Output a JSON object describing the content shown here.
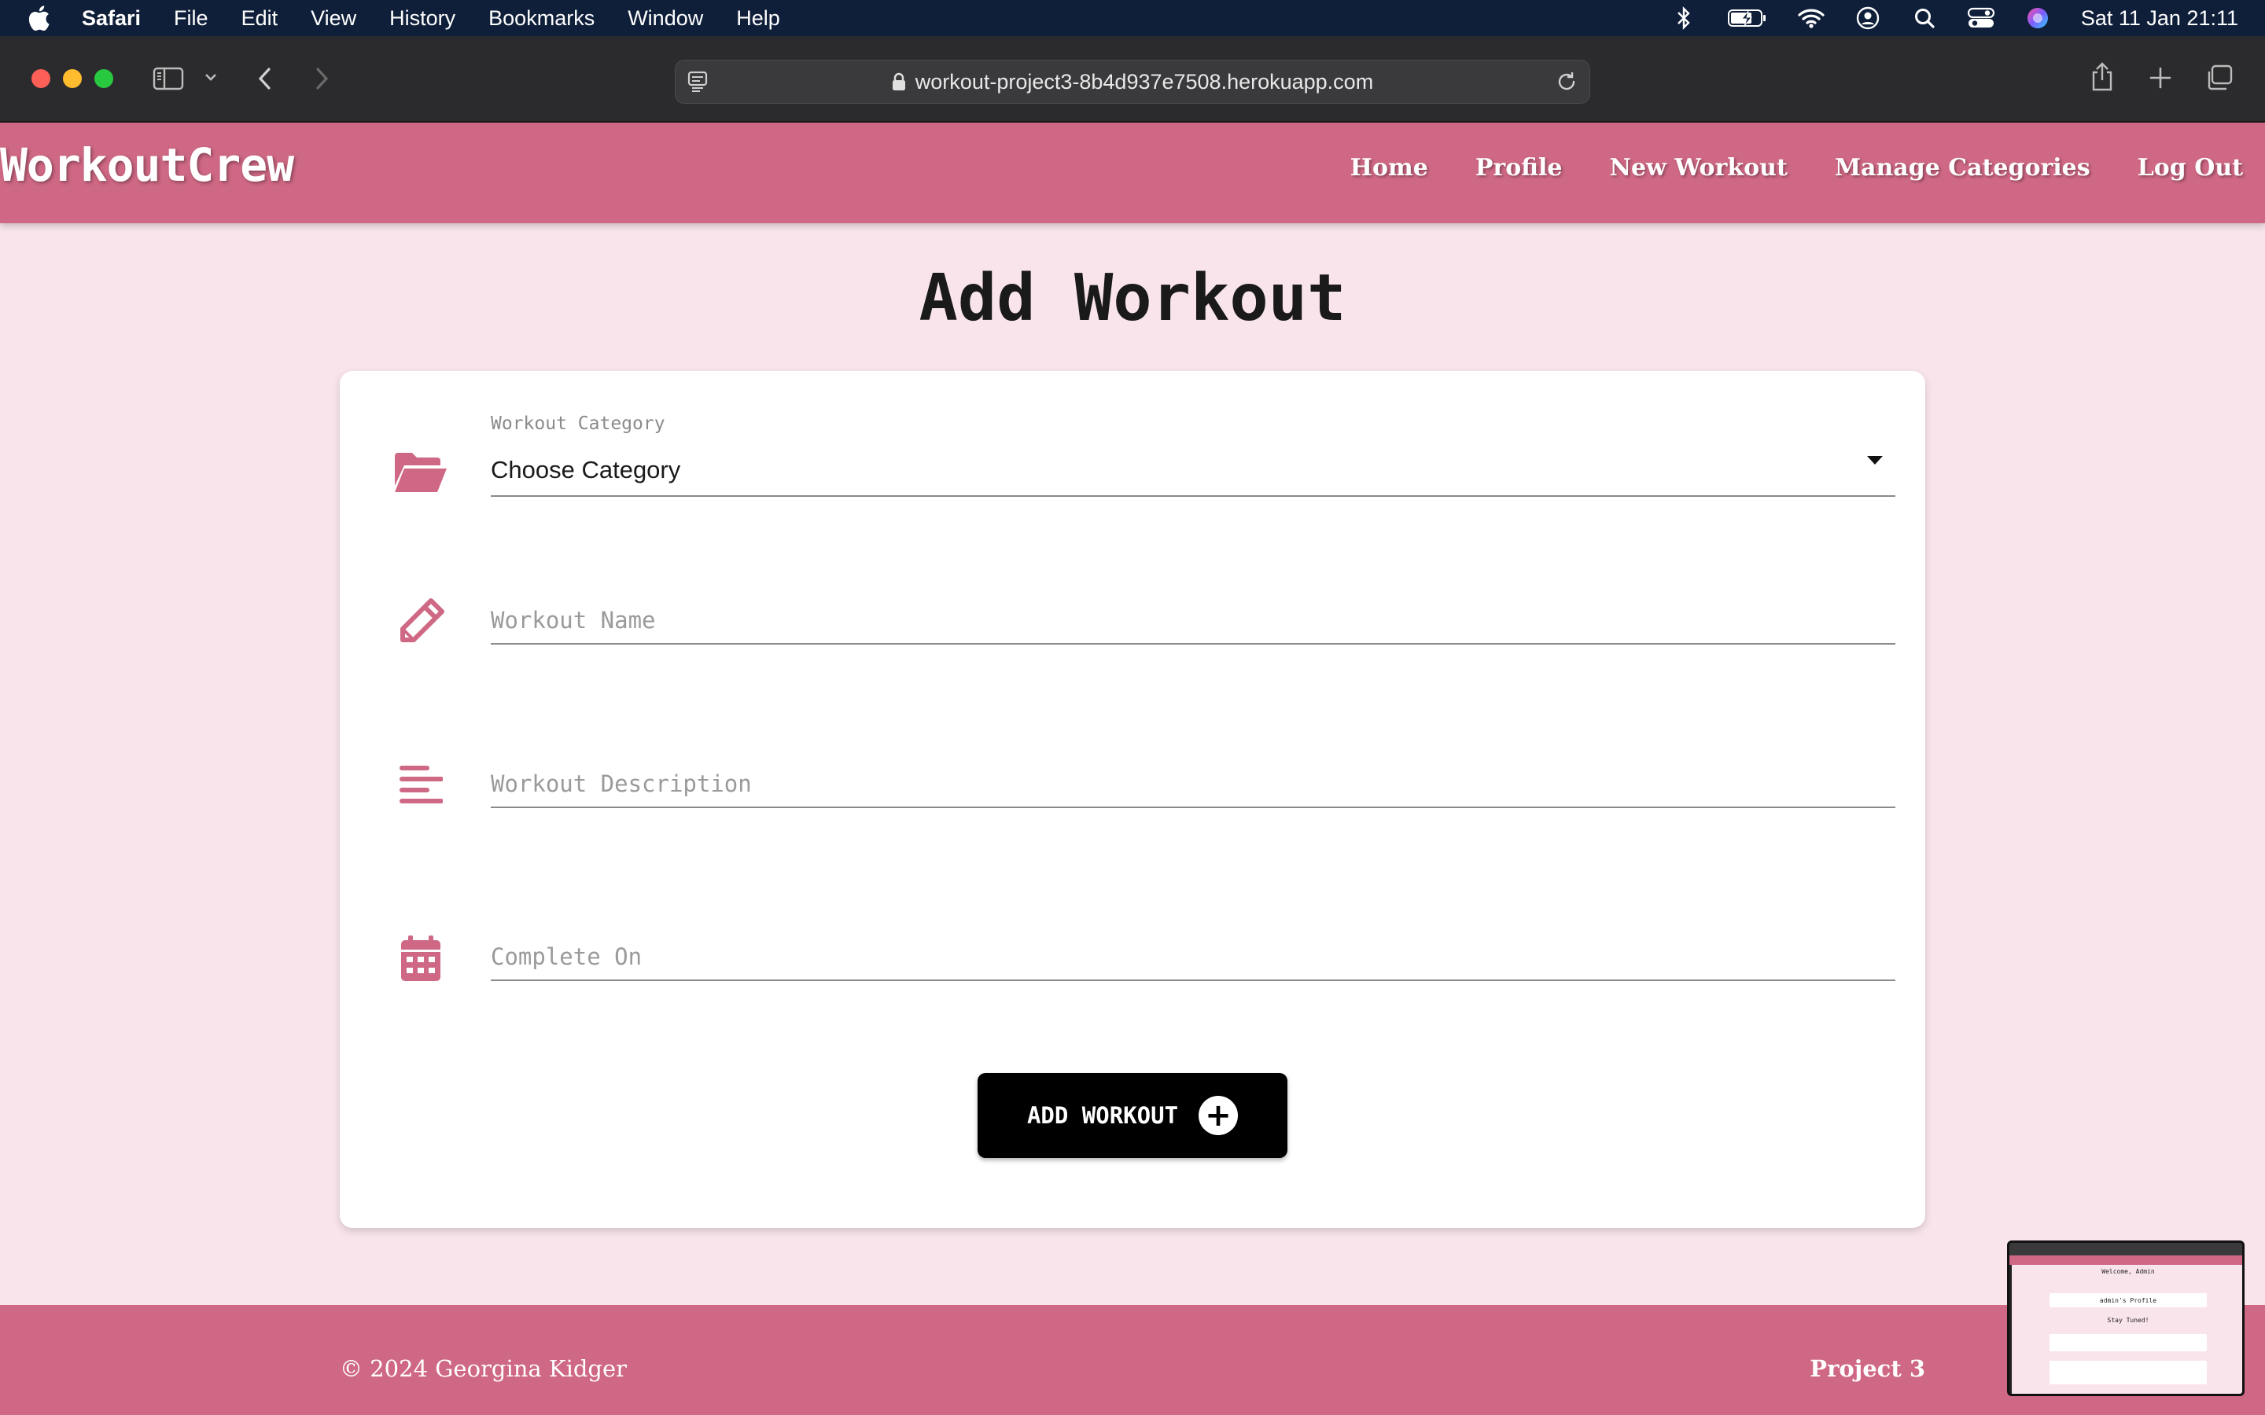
{
  "menubar": {
    "app_name": "Safari",
    "items": [
      "File",
      "Edit",
      "View",
      "History",
      "Bookmarks",
      "Window",
      "Help"
    ],
    "clock": "Sat 11 Jan  21:11"
  },
  "browser": {
    "url": "workout-project3-8b4d937e7508.herokuapp.com"
  },
  "site": {
    "brand": "WorkoutCrew",
    "nav": [
      "Home",
      "Profile",
      "New Workout",
      "Manage Categories",
      "Log Out"
    ]
  },
  "page": {
    "title": "Add Workout",
    "category_field": {
      "label": "Workout Category",
      "value": "Choose Category",
      "icon": "folder-open-icon"
    },
    "name_field": {
      "placeholder": "Workout Name",
      "icon": "pencil-icon"
    },
    "description_field": {
      "placeholder": "Workout Description",
      "icon": "align-left-icon"
    },
    "date_field": {
      "placeholder": "Complete On",
      "icon": "calendar-icon"
    },
    "submit_label": "ADD WORKOUT"
  },
  "footer": {
    "copyright": "© 2024 Georgina Kidger",
    "project": "Project 3"
  },
  "thumbnail": {
    "welcome": "Welcome, Admin",
    "profile": "admin's Profile",
    "stay_tuned": "Stay Tuned!"
  },
  "colors": {
    "accent": "#cf6884",
    "page_bg": "#f9e4ec",
    "menubar_bg": "#0f1f3a"
  }
}
